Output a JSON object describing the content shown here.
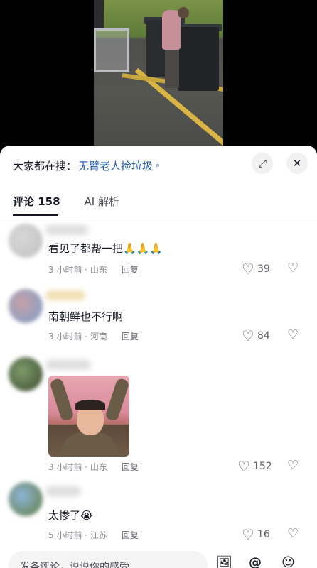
{
  "search": {
    "prefix": "大家都在搜：",
    "term": "无臂老人捡垃圾",
    "arrow": "⌕"
  },
  "header_buttons": {
    "expand_icon": "⤢",
    "close_icon": "✕"
  },
  "tabs": [
    {
      "label": "评论 158"
    },
    {
      "label": "AI 解析"
    }
  ],
  "comments": [
    {
      "text": "看见了都帮一把🙏🙏🙏",
      "time": "3 小时前 · 山东",
      "reply": "回复",
      "likes": "39"
    },
    {
      "text": "南朝鲜也不行啊",
      "time": "3 小时前 · 河南",
      "reply": "回复",
      "likes": "84"
    },
    {
      "text": "",
      "time": "3 小时前 · 山东",
      "reply": "回复",
      "likes": "152"
    },
    {
      "text": "太惨了😭",
      "time": "5 小时前 · 江苏",
      "reply": "回复",
      "likes": "16"
    }
  ],
  "input": {
    "placeholder": "发条评论，说说你的感受"
  },
  "bottom_icons": {
    "image_icon": "🖼",
    "at_icon": "@",
    "emoji_icon": "☺"
  },
  "like_icon": "♡",
  "dislike_icon": "♡"
}
